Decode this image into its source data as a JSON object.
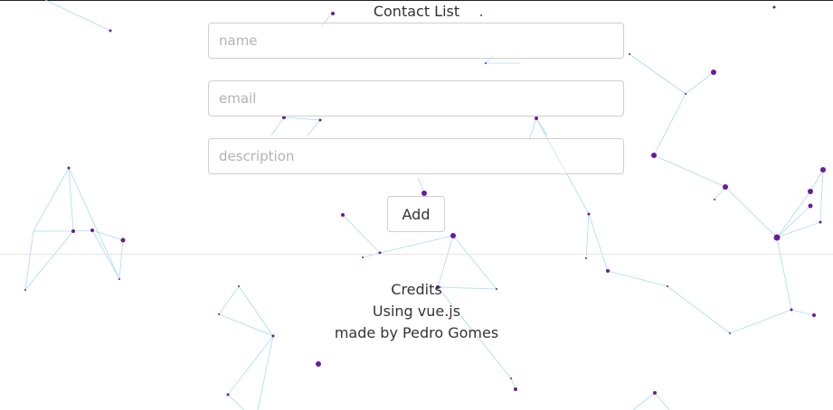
{
  "header": {
    "title": "Contact List"
  },
  "form": {
    "name_placeholder": "name",
    "email_placeholder": "email",
    "description_placeholder": "description",
    "add_label": "Add"
  },
  "footer": {
    "heading": "Credits",
    "line1": "Using vue.js",
    "line2": "made by Pedro Gomes"
  },
  "colors": {
    "node": "#6a1b9a",
    "link": "#a7dcef",
    "divider": "#e6e6e6",
    "text": "#333333"
  }
}
